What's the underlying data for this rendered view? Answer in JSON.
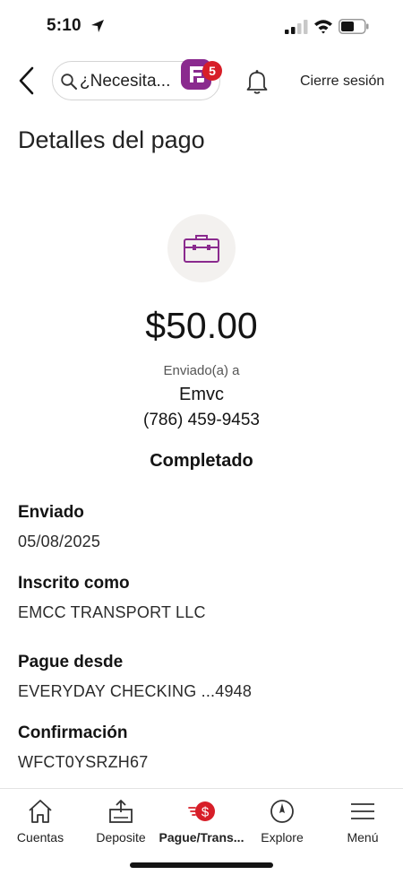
{
  "status_bar": {
    "time": "5:10"
  },
  "header": {
    "search_text": "¿Necesita...",
    "notifications_badge": "5",
    "logout_label": "Cierre sesión"
  },
  "page_title": "Detalles del pago",
  "payment": {
    "amount": "$50.00",
    "sent_to_label": "Enviado(a) a",
    "recipient_name": "Emvc",
    "recipient_phone": "(786) 459-9453",
    "status": "Completado"
  },
  "details": [
    {
      "label": "Enviado",
      "value": "05/08/2025"
    },
    {
      "label": "Inscrito como",
      "value": "EMCC TRANSPORT LLC"
    },
    {
      "label": "Pague desde",
      "value": "EVERYDAY CHECKING ...4948"
    },
    {
      "label": "Confirmación",
      "value": "WFCT0YSRZH67"
    }
  ],
  "bottom_nav": [
    {
      "label": "Cuentas",
      "icon": "home-icon"
    },
    {
      "label": "Deposite",
      "icon": "deposit-icon"
    },
    {
      "label": "Pague/Trans...",
      "icon": "pay-transfer-icon",
      "active": true
    },
    {
      "label": "Explore",
      "icon": "compass-icon"
    },
    {
      "label": "Menú",
      "icon": "hamburger-menu-icon"
    }
  ],
  "colors": {
    "accent_purple": "#8a2a8e",
    "badge_red": "#d71e28",
    "icon_bg": "#f3f1ef"
  }
}
